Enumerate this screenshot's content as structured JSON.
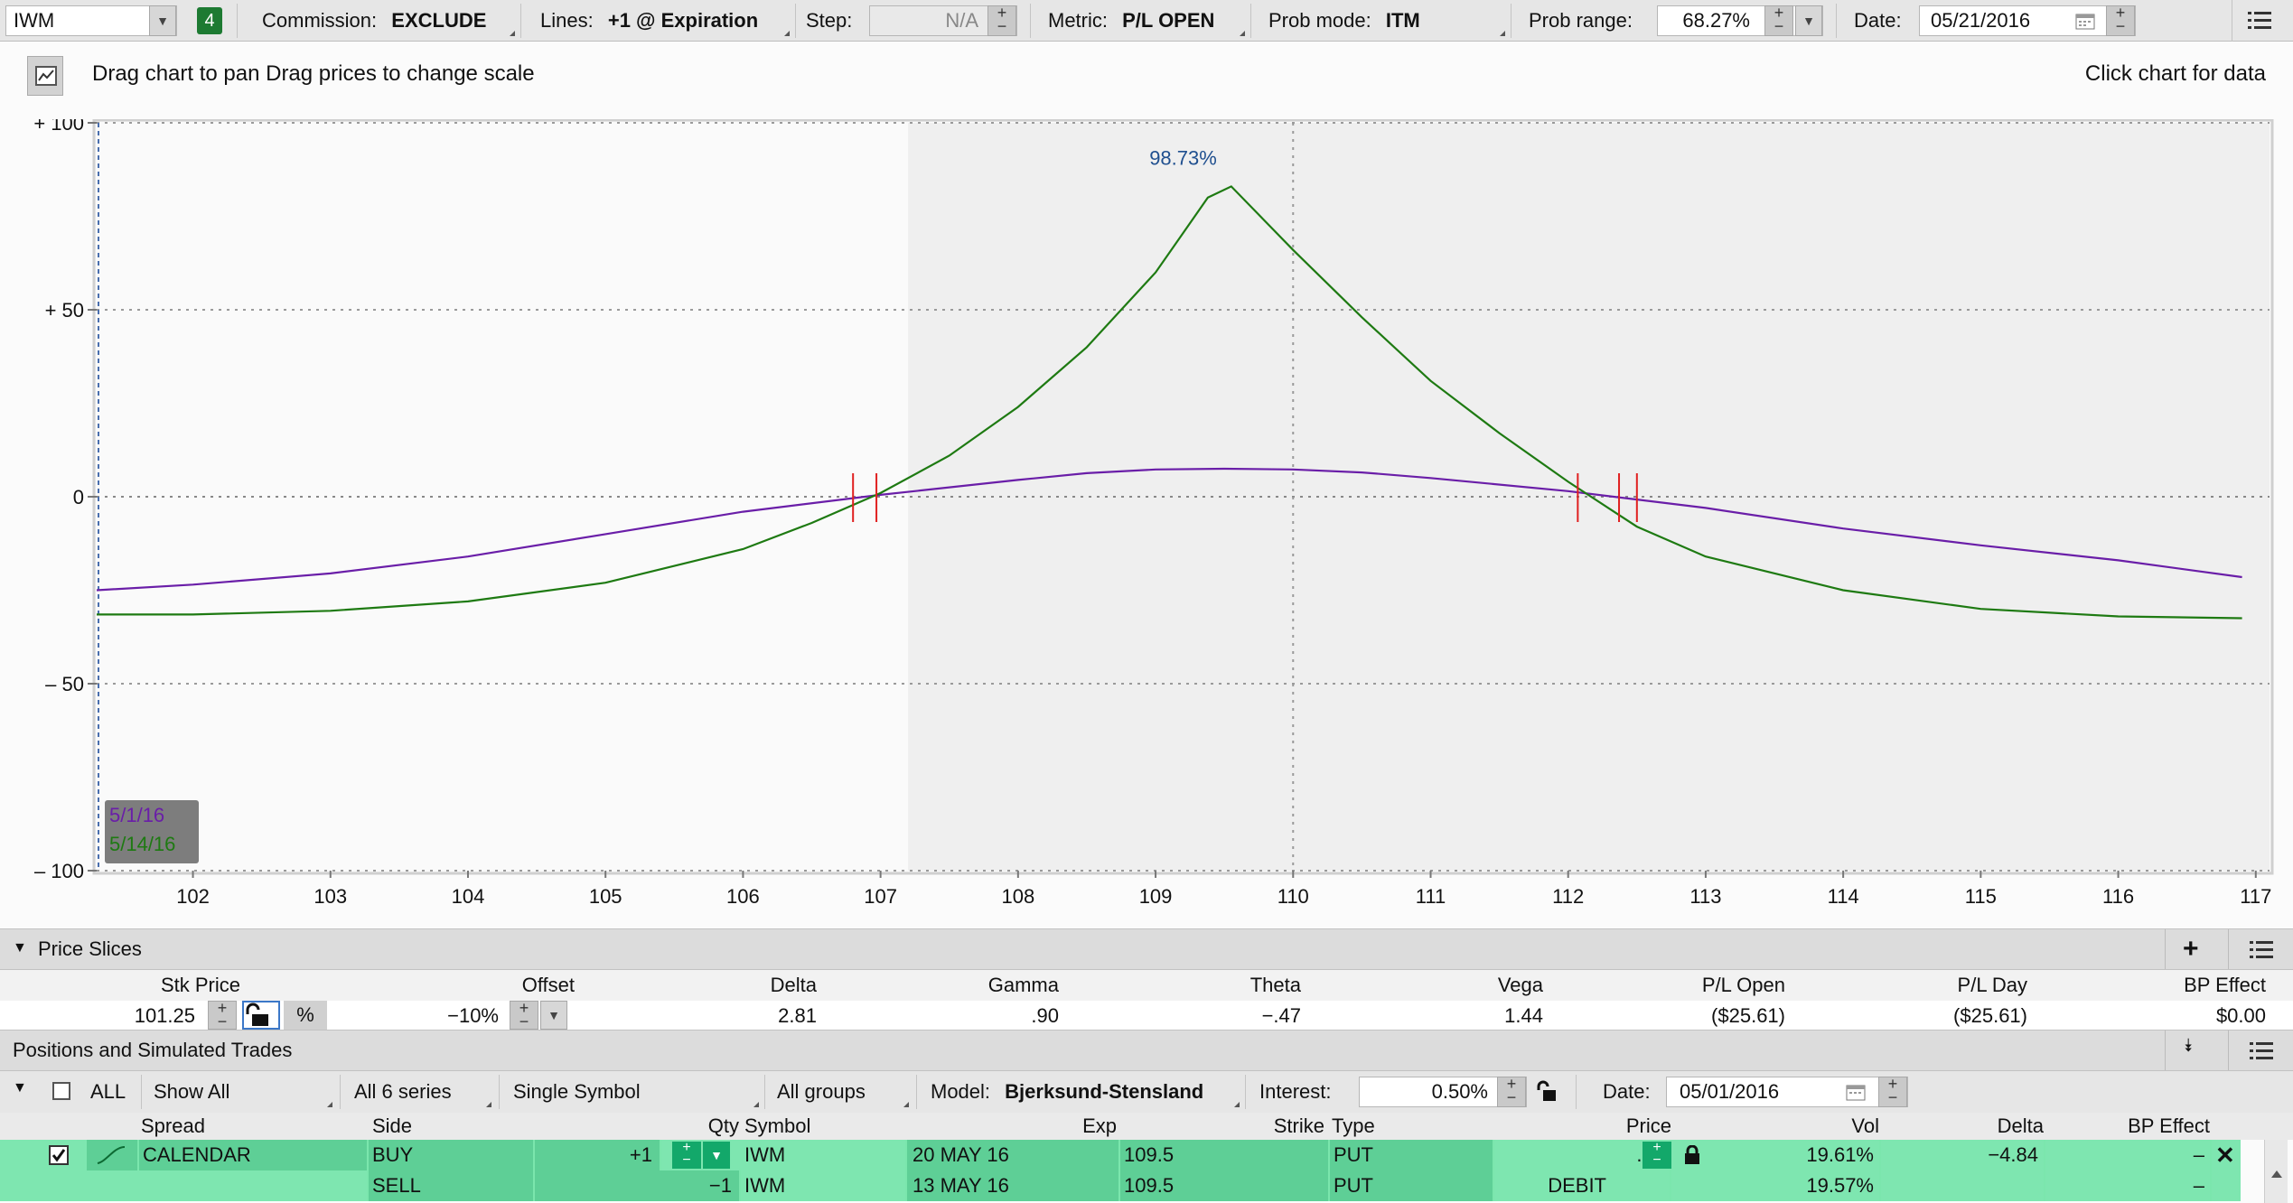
{
  "toolbar": {
    "symbol": "IWM",
    "badge": "4",
    "commission_label": "Commission:",
    "commission_value": "EXCLUDE",
    "lines_label": "Lines:",
    "lines_value": "+1 @ Expiration",
    "step_label": "Step:",
    "step_value": "N/A",
    "metric_label": "Metric:",
    "metric_value": "P/L OPEN",
    "prob_mode_label": "Prob mode:",
    "prob_mode_value": "ITM",
    "prob_range_label": "Prob range:",
    "prob_range_value": "68.27%",
    "date_label": "Date:",
    "date_value": "05/21/2016"
  },
  "chart_header": {
    "hint": "Drag chart to pan Drag prices to change scale",
    "click_hint": "Click chart for data"
  },
  "chart_data": {
    "type": "line",
    "xlim": [
      101.3,
      117.1
    ],
    "ylim": [
      -100,
      100
    ],
    "x_ticks": [
      "102",
      "103",
      "104",
      "105",
      "106",
      "107",
      "108",
      "109",
      "110",
      "111",
      "112",
      "113",
      "114",
      "115",
      "116",
      "117"
    ],
    "y_ticks": [
      "+ 100",
      "+ 50",
      "0",
      "– 50",
      "– 100"
    ],
    "probability_label": "98.73%",
    "shaded_range": [
      107.2,
      117.1
    ],
    "series": [
      {
        "name": "5/1/16",
        "color": "#6a1ea8",
        "points": [
          [
            101.3,
            -25
          ],
          [
            102,
            -23.5
          ],
          [
            103,
            -20.5
          ],
          [
            104,
            -16
          ],
          [
            105,
            -10
          ],
          [
            106,
            -4
          ],
          [
            107,
            0.5
          ],
          [
            108,
            4.5
          ],
          [
            108.5,
            6.3
          ],
          [
            109,
            7.3
          ],
          [
            109.5,
            7.5
          ],
          [
            110,
            7.3
          ],
          [
            110.5,
            6.5
          ],
          [
            111,
            5
          ],
          [
            112,
            1.5
          ],
          [
            113,
            -3
          ],
          [
            114,
            -8.5
          ],
          [
            115,
            -13
          ],
          [
            116,
            -17
          ],
          [
            116.9,
            -21.5
          ]
        ]
      },
      {
        "name": "5/14/16",
        "color": "#1e7a12",
        "points": [
          [
            101.3,
            -31.5
          ],
          [
            102,
            -31.5
          ],
          [
            103,
            -30.5
          ],
          [
            104,
            -28
          ],
          [
            105,
            -23
          ],
          [
            106,
            -14
          ],
          [
            106.5,
            -7
          ],
          [
            107,
            1
          ],
          [
            107.5,
            11
          ],
          [
            108,
            24
          ],
          [
            108.5,
            40
          ],
          [
            109,
            60
          ],
          [
            109.38,
            80
          ],
          [
            109.55,
            83
          ],
          [
            110,
            66
          ],
          [
            110.5,
            48
          ],
          [
            111,
            31
          ],
          [
            111.5,
            17
          ],
          [
            112,
            4
          ],
          [
            112.5,
            -8
          ],
          [
            113,
            -16
          ],
          [
            114,
            -25
          ],
          [
            115,
            -30
          ],
          [
            116,
            -32
          ],
          [
            116.9,
            -32.5
          ]
        ]
      }
    ],
    "breakevens": [
      106.8,
      106.97,
      112.07,
      112.37,
      112.5
    ]
  },
  "price_slices": {
    "title": "Price Slices",
    "headers": [
      "Stk Price",
      "Offset",
      "Delta",
      "Gamma",
      "Theta",
      "Vega",
      "P/L Open",
      "P/L Day",
      "BP Effect"
    ],
    "row": {
      "stk_price": "101.25",
      "pct": "%",
      "offset": "−10%",
      "delta": "2.81",
      "gamma": ".90",
      "theta": "−.47",
      "vega": "1.44",
      "pl_open": "($25.61)",
      "pl_day": "($25.61)",
      "bp_effect": "$0.00"
    }
  },
  "positions": {
    "title": "Positions and Simulated Trades",
    "filter": {
      "all_label": "ALL",
      "show_all": "Show All",
      "series": "All 6 series",
      "symbol_mode": "Single Symbol",
      "groups": "All groups",
      "model_label": "Model:",
      "model_value": "Bjerksund-Stensland",
      "interest_label": "Interest:",
      "interest_value": "0.50%",
      "date_label": "Date:",
      "date_value": "05/01/2016"
    },
    "headers": [
      "Spread",
      "Side",
      "Qty",
      "Symbol",
      "Exp",
      "Strike",
      "Type",
      "Price",
      "Vol",
      "Delta",
      "BP Effect"
    ],
    "rows": [
      {
        "spread": "CALENDAR",
        "side": "BUY",
        "qty": "+1",
        "symbol": "IWM",
        "exp": "20 MAY 16",
        "strike": "109.5",
        "type": "PUT",
        "price": ".33",
        "vol": "19.61%",
        "delta": "−4.84",
        "bp": "–"
      },
      {
        "spread": "",
        "side": "SELL",
        "qty": "−1",
        "symbol": "IWM",
        "exp": "13 MAY 16",
        "strike": "109.5",
        "type": "PUT",
        "price": "DEBIT",
        "vol": "19.57%",
        "delta": "",
        "bp": "–"
      }
    ]
  },
  "icons": [
    "chart-style-icon",
    "calendar-icon",
    "menu-icon",
    "plus-icon",
    "chevron-down-icon",
    "lock-icon",
    "close-icon",
    "checkbox-icon"
  ]
}
